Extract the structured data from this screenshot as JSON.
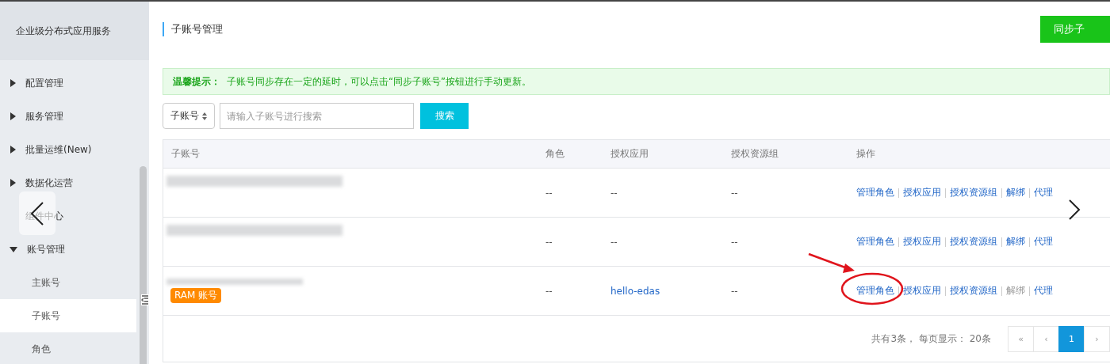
{
  "sidebar": {
    "title": "企业级分布式应用服务",
    "items": [
      {
        "label": "配置管理",
        "expanded": false
      },
      {
        "label": "服务管理",
        "expanded": false
      },
      {
        "label": "批量运维(New)",
        "expanded": false
      },
      {
        "label": "数据化运营",
        "expanded": false
      },
      {
        "label": "组件中心"
      },
      {
        "label": "账号管理",
        "expanded": true,
        "children": [
          {
            "label": "主账号",
            "selected": false
          },
          {
            "label": "子账号",
            "selected": true
          },
          {
            "label": "角色",
            "selected": false
          }
        ]
      }
    ]
  },
  "page": {
    "title": "子账号管理",
    "sync_button": "同步子"
  },
  "notice": {
    "title": "温馨提示：",
    "text": "子账号同步存在一定的延时，可以点击“同步子账号”按钮进行手动更新。"
  },
  "search": {
    "select": "子账号",
    "placeholder": "请输入子账号进行搜索",
    "button": "搜索"
  },
  "table": {
    "columns": [
      "子账号",
      "角色",
      "授权应用",
      "授权资源组",
      "操作"
    ],
    "rows": [
      {
        "role": "--",
        "apps": "--",
        "apps_link": false,
        "groups": "--",
        "actions": [
          {
            "label": "管理角色",
            "disabled": false
          },
          {
            "label": "授权应用",
            "disabled": false
          },
          {
            "label": "授权资源组",
            "disabled": false
          },
          {
            "label": "解绑",
            "disabled": false
          },
          {
            "label": "代理",
            "disabled": false
          }
        ]
      },
      {
        "role": "--",
        "apps": "--",
        "apps_link": false,
        "groups": "--",
        "actions": [
          {
            "label": "管理角色",
            "disabled": false
          },
          {
            "label": "授权应用",
            "disabled": false
          },
          {
            "label": "授权资源组",
            "disabled": false
          },
          {
            "label": "解绑",
            "disabled": false
          },
          {
            "label": "代理",
            "disabled": false
          }
        ]
      },
      {
        "badge": "RAM 账号",
        "role": "--",
        "apps": "hello-edas",
        "apps_link": true,
        "groups": "--",
        "actions": [
          {
            "label": "管理角色",
            "disabled": false
          },
          {
            "label": "授权应用",
            "disabled": false
          },
          {
            "label": "授权资源组",
            "disabled": false
          },
          {
            "label": "解绑",
            "disabled": true
          },
          {
            "label": "代理",
            "disabled": false
          }
        ]
      }
    ]
  },
  "pagination": {
    "summary": "共有3条， 每页显示： 20条",
    "pages": [
      {
        "label": "«",
        "selected": false
      },
      {
        "label": "‹",
        "selected": false
      },
      {
        "label": "1",
        "selected": true
      },
      {
        "label": "›",
        "selected": false
      }
    ]
  }
}
